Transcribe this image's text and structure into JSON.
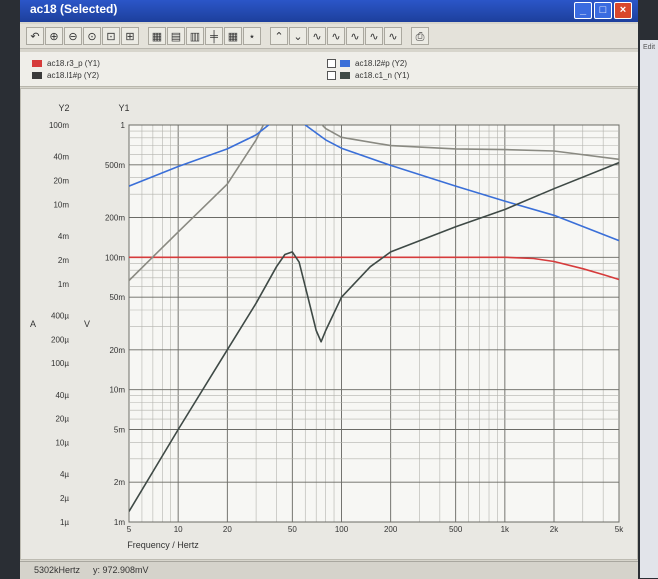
{
  "window": {
    "title": "ac18 (Selected)"
  },
  "toolbar": {
    "buttons": [
      "undo-icon",
      "zoom-in-icon",
      "zoom-out-icon",
      "zoom-fit-icon",
      "cursor-a-icon",
      "cursor-b-icon",
      "grid-icon",
      "grid-minor-icon",
      "grid-major-icon",
      "axis-icon",
      "table-icon",
      "markers-icon",
      "peak-icon",
      "valley-icon",
      "wave-a-icon",
      "wave-b-icon",
      "wave-c-icon",
      "wave-d-icon",
      "wave-e-icon",
      "print-icon"
    ]
  },
  "right_panel": {
    "menu": "Edit"
  },
  "legend": [
    {
      "label": "ac18.r3_p (Y1)",
      "color": "#d63b3b",
      "checkbox": false
    },
    {
      "label": "ac18.l1#p (Y2)",
      "color": "#3a3a3a",
      "checkbox": false
    },
    {
      "label": "ac18.l2#p (Y2)",
      "color": "#3a6fd8",
      "checkbox": true
    },
    {
      "label": "ac18.c1_n (Y1)",
      "color": "#3f4a46",
      "checkbox": true
    }
  ],
  "status": {
    "x_readout": "5302kHertz",
    "y_readout": "y: 972.908mV"
  },
  "chart_data": {
    "type": "line",
    "xlabel": "Frequency / Hertz",
    "x_scale": "log",
    "xlim": [
      5,
      5000
    ],
    "x_ticks": [
      "5",
      "10",
      "20",
      "50",
      "100",
      "200",
      "500",
      "1k",
      "2k",
      "5k"
    ],
    "y1": {
      "label": "Y1",
      "unit_symbol": "V",
      "scale": "log",
      "lim": [
        0.001,
        1
      ],
      "ticks": [
        "1",
        "500m",
        "200m",
        "100m",
        "50m",
        "20m",
        "10m",
        "5m",
        "2m",
        "1m"
      ]
    },
    "y2": {
      "label": "Y2",
      "unit_symbol": "A",
      "scale": "log",
      "lim": [
        1e-06,
        0.1
      ],
      "ticks": [
        "100m",
        "40m",
        "20m",
        "10m",
        "4m",
        "2m",
        "1m",
        "400µ",
        "200µ",
        "100µ",
        "40µ",
        "20µ",
        "10µ",
        "4µ",
        "2µ",
        "1µ"
      ]
    },
    "grid": true,
    "series": [
      {
        "name": "ac18.r3_p (Y1)",
        "color": "#d63b3b",
        "x": [
          5,
          10,
          20,
          40,
          50,
          60,
          100,
          200,
          500,
          1000,
          1500,
          2000,
          3000,
          4000,
          5000
        ],
        "y": [
          0.1,
          0.1,
          0.1,
          0.1,
          0.1,
          0.1,
          0.1,
          0.1,
          0.1,
          0.1,
          0.098,
          0.093,
          0.082,
          0.074,
          0.068
        ]
      },
      {
        "name": "ac18.l1#p (Y2)",
        "color": "#8a8a82",
        "x": [
          5,
          10,
          20,
          30,
          40,
          45,
          50,
          55,
          60,
          70,
          80,
          100,
          200,
          500,
          1000,
          2000,
          5000
        ],
        "y": [
          0.0011,
          0.0045,
          0.018,
          0.065,
          0.22,
          0.4,
          0.55,
          0.4,
          0.22,
          0.12,
          0.09,
          0.07,
          0.055,
          0.05,
          0.049,
          0.047,
          0.037
        ]
      },
      {
        "name": "ac18.l2#p (Y2)",
        "color": "#3a6fd8",
        "x": [
          5,
          10,
          20,
          30,
          40,
          45,
          50,
          55,
          60,
          80,
          100,
          200,
          500,
          1000,
          2000,
          5000
        ],
        "y": [
          0.017,
          0.03,
          0.05,
          0.075,
          0.12,
          0.15,
          0.17,
          0.14,
          0.1,
          0.065,
          0.051,
          0.031,
          0.017,
          0.011,
          0.0073,
          0.0035
        ]
      },
      {
        "name": "ac18.c1_n (Y1)",
        "color": "#3f4a46",
        "x": [
          5,
          10,
          20,
          30,
          40,
          45,
          50,
          55,
          60,
          70,
          75,
          80,
          100,
          150,
          200,
          500,
          1000,
          2000,
          5000
        ],
        "y": [
          0.0012,
          0.005,
          0.02,
          0.045,
          0.085,
          0.105,
          0.11,
          0.092,
          0.06,
          0.028,
          0.023,
          0.028,
          0.05,
          0.085,
          0.11,
          0.17,
          0.23,
          0.33,
          0.52
        ]
      }
    ]
  }
}
